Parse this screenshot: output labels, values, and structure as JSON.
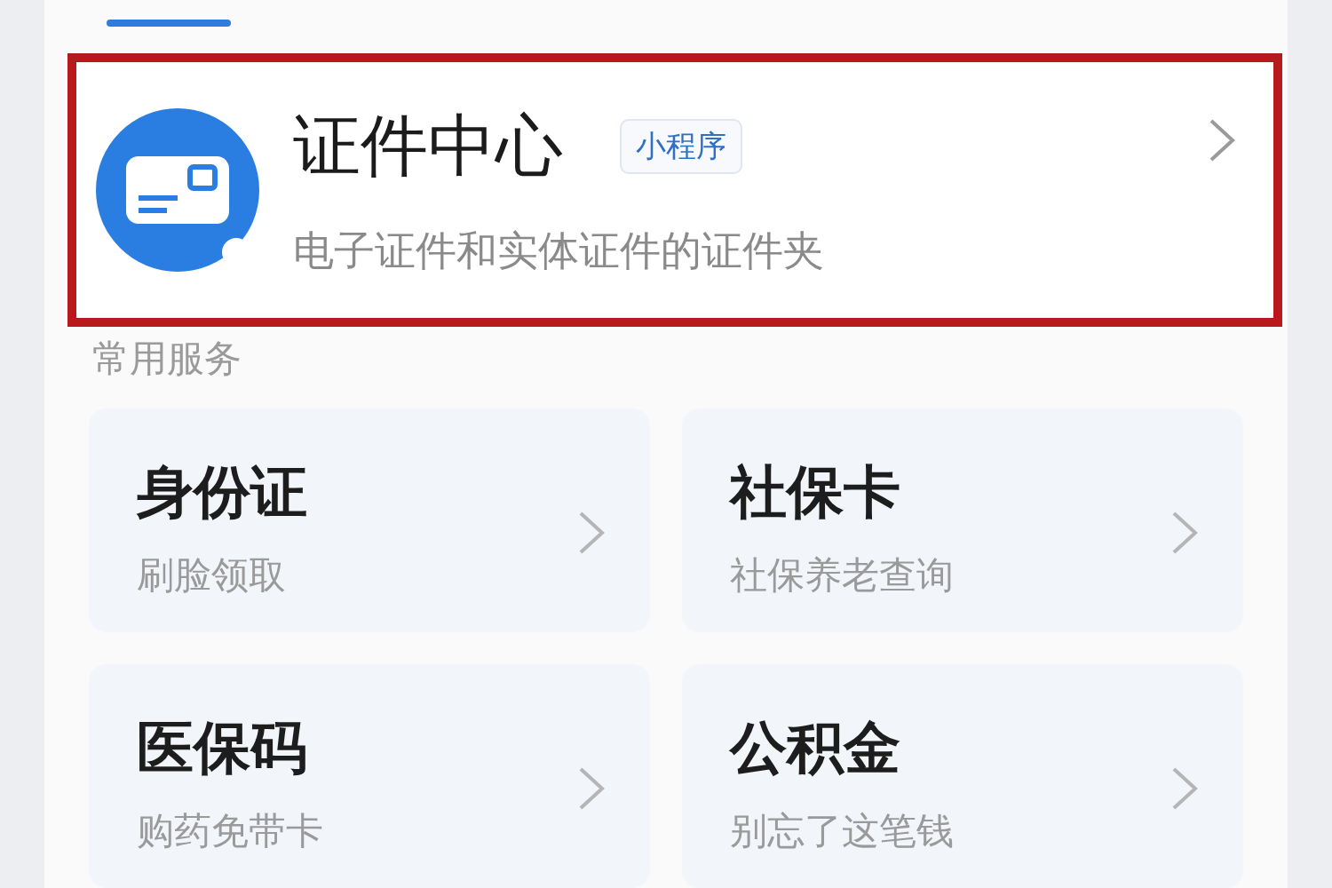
{
  "tab_indicator": {
    "selected": true
  },
  "feature": {
    "title": "证件中心",
    "badge": "小程序",
    "subtitle": "电子证件和实体证件的证件夹",
    "highlighted": true
  },
  "section": {
    "title": "常用服务"
  },
  "services": [
    {
      "title": "身份证",
      "subtitle": "刷脸领取"
    },
    {
      "title": "社保卡",
      "subtitle": "社保养老查询"
    },
    {
      "title": "医保码",
      "subtitle": "购药免带卡"
    },
    {
      "title": "公积金",
      "subtitle": "别忘了这笔钱"
    }
  ]
}
